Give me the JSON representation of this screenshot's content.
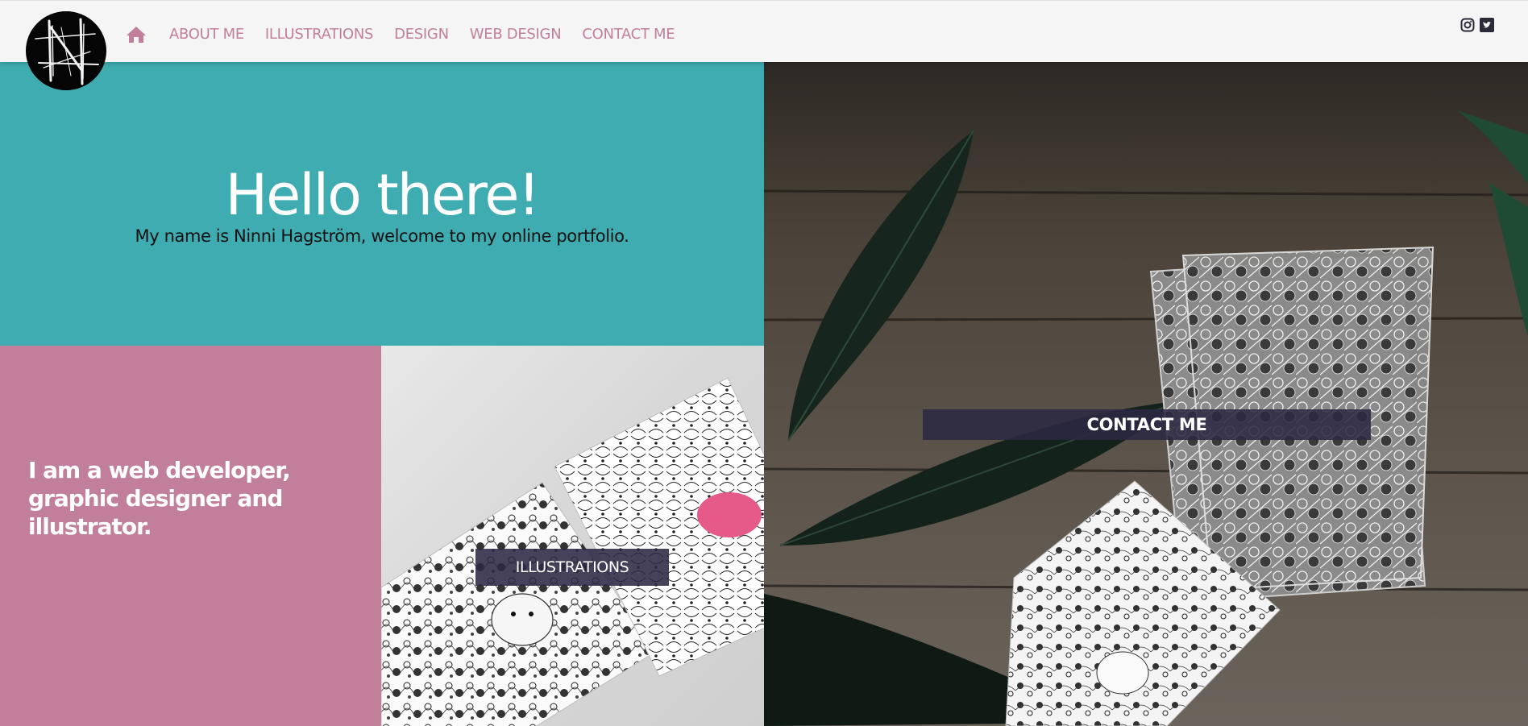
{
  "brand": {
    "accent": "#c17f9b",
    "teal": "#3eacb1",
    "pink": "#c27f9c",
    "button_bg": "#2b2842"
  },
  "nav": {
    "home_icon": "home-icon",
    "items": [
      {
        "label": "ABOUT ME"
      },
      {
        "label": "ILLUSTRATIONS"
      },
      {
        "label": "DESIGN"
      },
      {
        "label": "WEB DESIGN"
      },
      {
        "label": "CONTACT ME"
      }
    ]
  },
  "social": {
    "icons": [
      "instagram-icon",
      "twitter-icon"
    ]
  },
  "hero": {
    "title": "Hello there!",
    "subtitle": "My name is Ninni Hagström, welcome to my online portfolio."
  },
  "about": {
    "text": "I am a web developer, graphic designer and illustrator."
  },
  "tiles": {
    "illustrations_button": "ILLUSTRATIONS",
    "contact_button": "CONTACT ME"
  }
}
